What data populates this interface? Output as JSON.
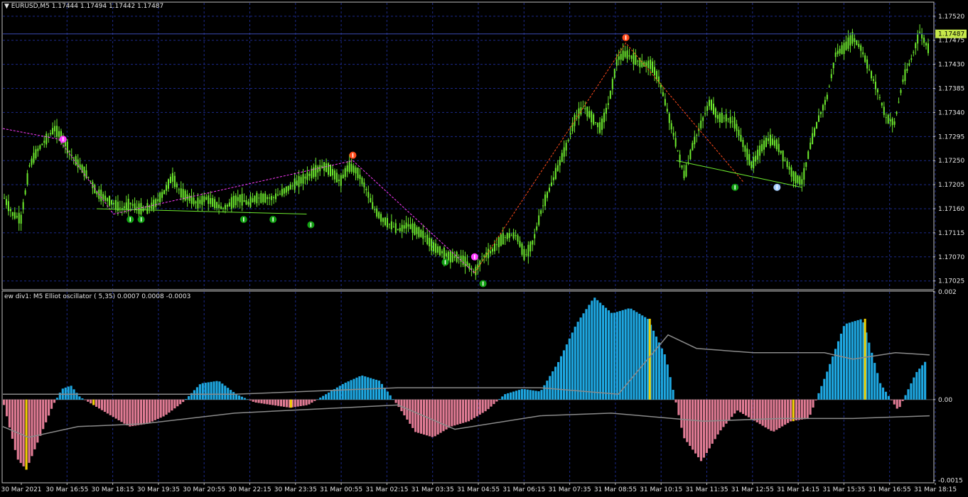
{
  "header": {
    "symbol": "EURUSD,M5",
    "ohlc": "1.17444 1.17494 1.17442 1.17487"
  },
  "indicator_header": "ew div1: M5 Elliot oscillator ( 5,35) 0.0007 0.0008 -0.0003",
  "current_price_label": "1.17487",
  "colors": {
    "background": "#000000",
    "frame": "#c0c0c0",
    "grid": "#1c2a8a",
    "candles": "#6dea2e",
    "osc_positive": "#1ea7e1",
    "osc_negative": "#e07b94",
    "signal_line": "#8a8a8a",
    "highlight_bar": "#f0d000",
    "price_marker": "#c6e84a",
    "bearish": "#ff4a1a",
    "bullish": "#12a012",
    "wave_magenta": "#ff3cff",
    "wave_light": "#a8d0ff"
  },
  "chart_data": [
    {
      "type": "candlestick",
      "title": "EURUSD,M5",
      "y_ticks": [
        "1.17520",
        "1.17475",
        "1.17430",
        "1.17385",
        "1.17340",
        "1.17295",
        "1.17250",
        "1.17205",
        "1.17160",
        "1.17115",
        "1.17070",
        "1.17025"
      ],
      "ylim": [
        1.1701,
        1.17545
      ],
      "x_ticks": [
        "30 Mar 2021",
        "30 Mar 16:55",
        "30 Mar 18:15",
        "30 Mar 19:35",
        "30 Mar 20:55",
        "30 Mar 22:15",
        "30 Mar 23:35",
        "31 Mar 00:55",
        "31 Mar 02:15",
        "31 Mar 03:35",
        "31 Mar 04:55",
        "31 Mar 06:15",
        "31 Mar 07:35",
        "31 Mar 08:55",
        "31 Mar 10:15",
        "31 Mar 11:35",
        "31 Mar 12:55",
        "31 Mar 14:15",
        "31 Mar 15:35",
        "31 Mar 16:55",
        "31 Mar 18:15"
      ],
      "close_path": [
        [
          0,
          1.1718
        ],
        [
          1,
          1.1715
        ],
        [
          2,
          1.1714
        ],
        [
          3,
          1.1724
        ],
        [
          4,
          1.1727
        ],
        [
          5,
          1.1729
        ],
        [
          6,
          1.1731
        ],
        [
          7,
          1.1729
        ],
        [
          8,
          1.1726
        ],
        [
          9,
          1.1724
        ],
        [
          10,
          1.1722
        ],
        [
          11,
          1.1719
        ],
        [
          12,
          1.1718
        ],
        [
          13,
          1.1717
        ],
        [
          14,
          1.1716
        ],
        [
          15,
          1.1717
        ],
        [
          16,
          1.1716
        ],
        [
          17,
          1.1716
        ],
        [
          18,
          1.1717
        ],
        [
          19,
          1.1719
        ],
        [
          20,
          1.1722
        ],
        [
          21,
          1.1719
        ],
        [
          22,
          1.1718
        ],
        [
          23,
          1.1717
        ],
        [
          24,
          1.1718
        ],
        [
          25,
          1.1717
        ],
        [
          26,
          1.1716
        ],
        [
          27,
          1.1717
        ],
        [
          28,
          1.1718
        ],
        [
          29,
          1.1717
        ],
        [
          30,
          1.1718
        ],
        [
          31,
          1.1718
        ],
        [
          32,
          1.1718
        ],
        [
          33,
          1.1719
        ],
        [
          34,
          1.172
        ],
        [
          35,
          1.1721
        ],
        [
          36,
          1.1722
        ],
        [
          37,
          1.1723
        ],
        [
          38,
          1.1724
        ],
        [
          39,
          1.1723
        ],
        [
          40,
          1.1721
        ],
        [
          41,
          1.1724
        ],
        [
          42,
          1.1723
        ],
        [
          43,
          1.172
        ],
        [
          44,
          1.1716
        ],
        [
          45,
          1.1714
        ],
        [
          46,
          1.1713
        ],
        [
          47,
          1.1712
        ],
        [
          48,
          1.1713
        ],
        [
          49,
          1.1712
        ],
        [
          50,
          1.1711
        ],
        [
          51,
          1.1709
        ],
        [
          52,
          1.1708
        ],
        [
          53,
          1.1707
        ],
        [
          54,
          1.1707
        ],
        [
          55,
          1.1706
        ],
        [
          56,
          1.1704
        ],
        [
          57,
          1.1707
        ],
        [
          58,
          1.1708
        ],
        [
          59,
          1.171
        ],
        [
          60,
          1.1711
        ],
        [
          61,
          1.1711
        ],
        [
          62,
          1.1707
        ],
        [
          63,
          1.171
        ],
        [
          64,
          1.1716
        ],
        [
          65,
          1.172
        ],
        [
          66,
          1.1724
        ],
        [
          67,
          1.1728
        ],
        [
          68,
          1.1733
        ],
        [
          69,
          1.1735
        ],
        [
          70,
          1.1733
        ],
        [
          71,
          1.1731
        ],
        [
          72,
          1.1736
        ],
        [
          73,
          1.1744
        ],
        [
          74,
          1.1745
        ],
        [
          75,
          1.1744
        ],
        [
          76,
          1.1743
        ],
        [
          77,
          1.1743
        ],
        [
          78,
          1.174
        ],
        [
          79,
          1.1734
        ],
        [
          80,
          1.1728
        ],
        [
          81,
          1.1722
        ],
        [
          82,
          1.1728
        ],
        [
          83,
          1.1732
        ],
        [
          84,
          1.1736
        ],
        [
          85,
          1.1733
        ],
        [
          86,
          1.1733
        ],
        [
          87,
          1.1732
        ],
        [
          88,
          1.1728
        ],
        [
          89,
          1.1724
        ],
        [
          90,
          1.1727
        ],
        [
          91,
          1.1729
        ],
        [
          92,
          1.1728
        ],
        [
          93,
          1.1725
        ],
        [
          94,
          1.1722
        ],
        [
          95,
          1.1721
        ],
        [
          96,
          1.1728
        ],
        [
          97,
          1.1733
        ],
        [
          98,
          1.1737
        ],
        [
          99,
          1.1745
        ],
        [
          100,
          1.1746
        ],
        [
          101,
          1.1748
        ],
        [
          102,
          1.1746
        ],
        [
          103,
          1.1742
        ],
        [
          104,
          1.1738
        ],
        [
          105,
          1.1733
        ],
        [
          106,
          1.1732
        ],
        [
          107,
          1.174
        ],
        [
          108,
          1.1744
        ],
        [
          109,
          1.1749
        ],
        [
          110,
          1.1746
        ]
      ]
    },
    {
      "type": "histogram",
      "title": "ew div1: M5 Elliot oscillator ( 5,35)",
      "y_ticks": [
        "0.002",
        "0.00",
        "-0.0015"
      ],
      "ylim": [
        -0.00153,
        0.002
      ],
      "values_by_bar_index": [
        [
          0,
          -0.0001
        ],
        [
          3,
          -0.0011
        ],
        [
          5,
          -0.0013
        ],
        [
          8,
          -0.0007
        ],
        [
          11,
          -0.0001
        ],
        [
          13,
          0.0002
        ],
        [
          15,
          0.00026
        ],
        [
          17,
          5e-05
        ],
        [
          20,
          -0.0001
        ],
        [
          24,
          -0.0003
        ],
        [
          28,
          -0.0005
        ],
        [
          32,
          -0.00045
        ],
        [
          36,
          -0.0003
        ],
        [
          40,
          -5e-05
        ],
        [
          44,
          0.0003
        ],
        [
          48,
          0.00035
        ],
        [
          52,
          0.0001
        ],
        [
          56,
          -5e-05
        ],
        [
          60,
          -0.0001
        ],
        [
          64,
          -0.00015
        ],
        [
          68,
          -0.0001
        ],
        [
          72,
          0.0001
        ],
        [
          76,
          0.0003
        ],
        [
          80,
          0.00045
        ],
        [
          84,
          0.00035
        ],
        [
          88,
          -0.0001
        ],
        [
          92,
          -0.0006
        ],
        [
          96,
          -0.0007
        ],
        [
          100,
          -0.0005
        ],
        [
          104,
          -0.0004
        ],
        [
          108,
          -0.0002
        ],
        [
          112,
          0.0001
        ],
        [
          116,
          0.0002
        ],
        [
          120,
          0.00015
        ],
        [
          124,
          0.0007
        ],
        [
          128,
          0.0014
        ],
        [
          132,
          0.0019
        ],
        [
          136,
          0.0016
        ],
        [
          140,
          0.0017
        ],
        [
          144,
          0.0015
        ],
        [
          148,
          0.0008
        ],
        [
          152,
          -0.0007
        ],
        [
          156,
          -0.00115
        ],
        [
          160,
          -0.0006
        ],
        [
          164,
          -0.0002
        ],
        [
          168,
          -0.0004
        ],
        [
          172,
          -0.0006
        ],
        [
          176,
          -0.0004
        ],
        [
          180,
          -0.00035
        ],
        [
          184,
          0.0005
        ],
        [
          188,
          0.0014
        ],
        [
          192,
          0.0015
        ],
        [
          196,
          0.0003
        ],
        [
          200,
          -0.0002
        ],
        [
          204,
          0.0005
        ],
        [
          206,
          0.0007
        ]
      ],
      "highlight_bars": [
        5,
        20,
        64,
        144,
        176,
        192
      ]
    }
  ]
}
